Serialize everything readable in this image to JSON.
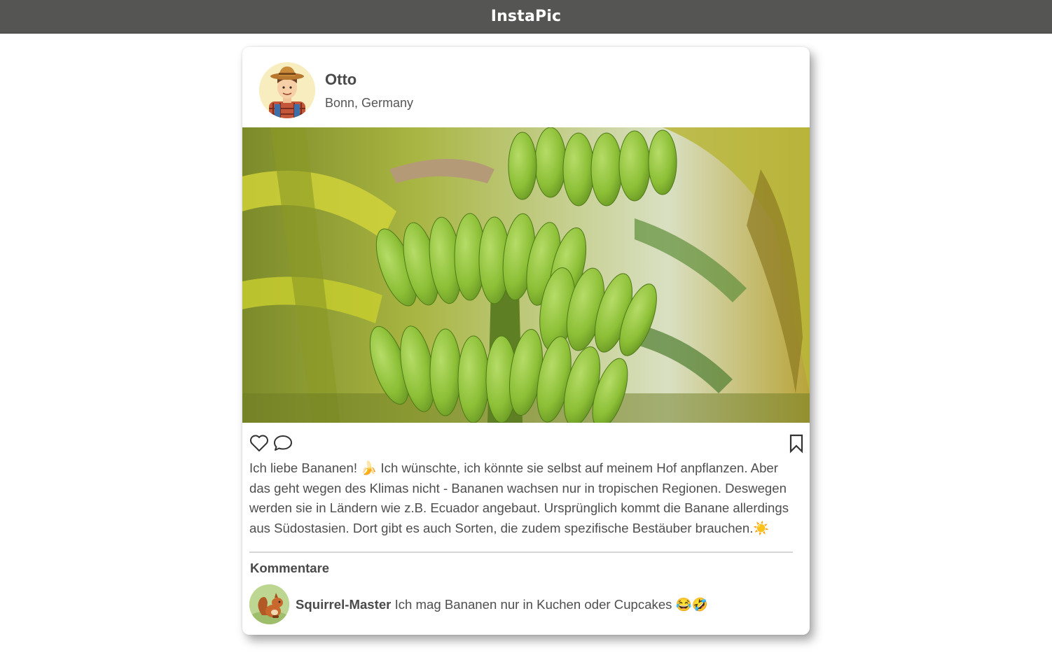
{
  "app": {
    "title": "InstaPic"
  },
  "post": {
    "user": {
      "name": "Otto",
      "location": "Bonn, Germany"
    },
    "caption": "Ich liebe Bananen! 🍌 Ich wünschte, ich könnte sie selbst auf meinem Hof anpflanzen. Aber das geht wegen des Klimas nicht - Bananen wachsen nur in tropischen Regionen. Deswegen werden sie in Ländern wie z.B. Ecuador angebaut. Ursprünglich kommt die Banane allerdings aus Südostasien. Dort gibt es auch Sorten, die zudem spezifische Bestäuber brauchen.☀️",
    "actions": {
      "icons": [
        "heart-icon",
        "comment-icon",
        "bookmark-icon"
      ]
    }
  },
  "comments": {
    "title": "Kommentare",
    "items": [
      {
        "user": "Squirrel-Master",
        "text": "Ich mag Bananen nur in Kuchen oder Cupcakes 😂🤣"
      }
    ]
  },
  "colors": {
    "topbar": "#555554",
    "text": "#4a4a4a",
    "banana": "#8fc23a"
  }
}
